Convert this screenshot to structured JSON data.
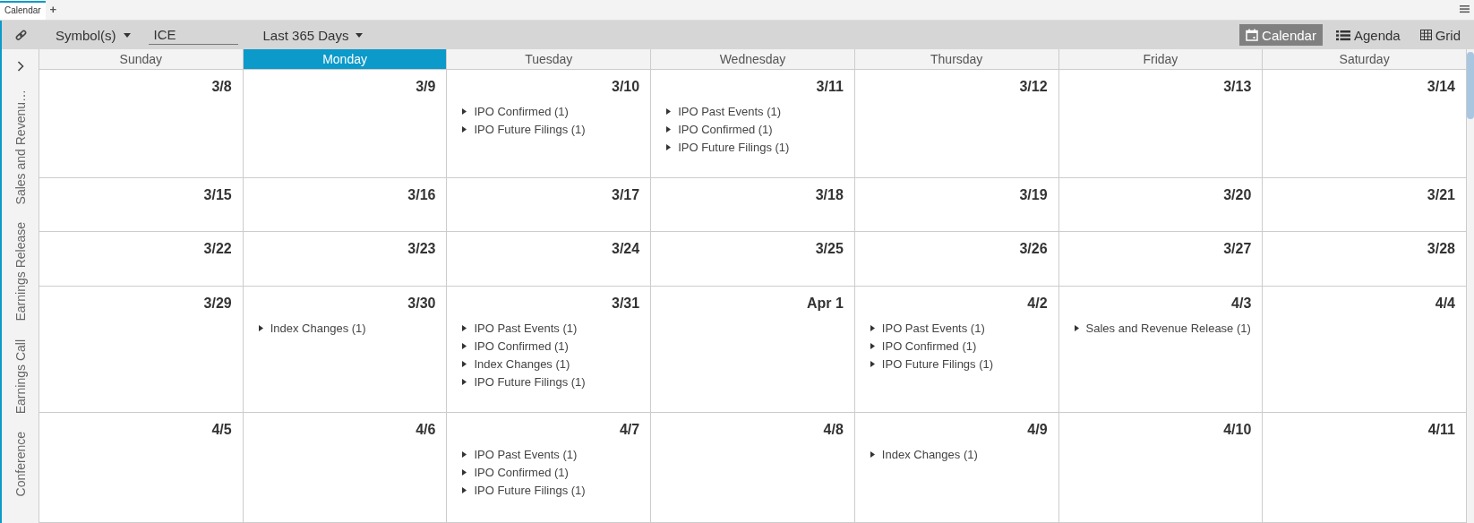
{
  "tabs": [
    {
      "label": "Calendar",
      "selected": true
    }
  ],
  "add_tab": "+",
  "toolbar": {
    "symbol_dropdown": "Symbol(s)",
    "symbol_value": "ICE",
    "range_dropdown": "Last 365 Days",
    "views": [
      {
        "label": "Calendar",
        "selected": true
      },
      {
        "label": "Agenda",
        "selected": false
      },
      {
        "label": "Grid",
        "selected": false
      }
    ]
  },
  "sidebar": {
    "items": [
      "Sales and Revenu…",
      "Earnings Release",
      "Earnings Call",
      "Conference"
    ]
  },
  "calendar": {
    "days": [
      {
        "label": "Sunday",
        "selected": false
      },
      {
        "label": "Monday",
        "selected": true
      },
      {
        "label": "Tuesday",
        "selected": false
      },
      {
        "label": "Wednesday",
        "selected": false
      },
      {
        "label": "Thursday",
        "selected": false
      },
      {
        "label": "Friday",
        "selected": false
      },
      {
        "label": "Saturday",
        "selected": false
      }
    ],
    "weeks": [
      {
        "cells": [
          {
            "date": "3/8"
          },
          {
            "date": "3/9"
          },
          {
            "date": "3/10",
            "events": [
              "IPO Confirmed (1)",
              "IPO Future Filings (1)"
            ]
          },
          {
            "date": "3/11",
            "events": [
              "IPO Past Events (1)",
              "IPO Confirmed (1)",
              "IPO Future Filings (1)"
            ]
          },
          {
            "date": "3/12"
          },
          {
            "date": "3/13"
          },
          {
            "date": "3/14"
          }
        ]
      },
      {
        "cells": [
          {
            "date": "3/15"
          },
          {
            "date": "3/16"
          },
          {
            "date": "3/17"
          },
          {
            "date": "3/18"
          },
          {
            "date": "3/19"
          },
          {
            "date": "3/20"
          },
          {
            "date": "3/21"
          }
        ]
      },
      {
        "cells": [
          {
            "date": "3/22"
          },
          {
            "date": "3/23"
          },
          {
            "date": "3/24"
          },
          {
            "date": "3/25"
          },
          {
            "date": "3/26"
          },
          {
            "date": "3/27"
          },
          {
            "date": "3/28"
          }
        ]
      },
      {
        "cells": [
          {
            "date": "3/29"
          },
          {
            "date": "3/30",
            "events": [
              "Index Changes (1)"
            ]
          },
          {
            "date": "3/31",
            "events": [
              "IPO Past Events (1)",
              "IPO Confirmed (1)",
              "Index Changes (1)",
              "IPO Future Filings (1)"
            ]
          },
          {
            "date": "Apr 1"
          },
          {
            "date": "4/2",
            "events": [
              "IPO Past Events (1)",
              "IPO Confirmed (1)",
              "IPO Future Filings (1)"
            ]
          },
          {
            "date": "4/3",
            "events": [
              "Sales and Revenue Release (1)"
            ]
          },
          {
            "date": "4/4"
          }
        ]
      },
      {
        "cells": [
          {
            "date": "4/5"
          },
          {
            "date": "4/6"
          },
          {
            "date": "4/7",
            "events": [
              "IPO Past Events (1)",
              "IPO Confirmed (1)",
              "IPO Future Filings (1)"
            ]
          },
          {
            "date": "4/8"
          },
          {
            "date": "4/9",
            "events": [
              "Index Changes (1)"
            ]
          },
          {
            "date": "4/10"
          },
          {
            "date": "4/11"
          }
        ]
      }
    ]
  }
}
